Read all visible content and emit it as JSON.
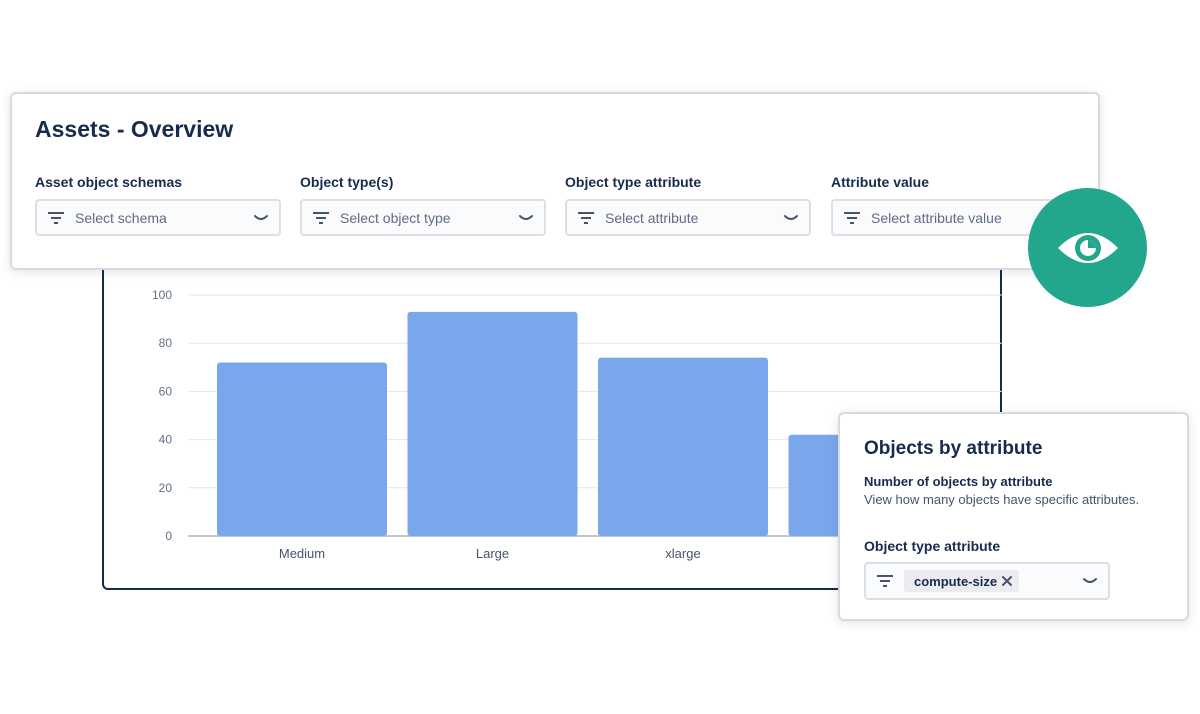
{
  "overview": {
    "title": "Assets - Overview",
    "filters": [
      {
        "label": "Asset object schemas",
        "placeholder": "Select schema"
      },
      {
        "label": "Object type(s)",
        "placeholder": "Select object type"
      },
      {
        "label": "Object type attribute",
        "placeholder": "Select attribute"
      },
      {
        "label": "Attribute value",
        "placeholder": "Select attribute value"
      }
    ]
  },
  "chart_data": {
    "type": "bar",
    "categories": [
      "Medium",
      "Large",
      "xlarge",
      ""
    ],
    "values": [
      72,
      93,
      74,
      42
    ],
    "yticks": [
      "0",
      "20",
      "40",
      "60",
      "80",
      "100"
    ],
    "ylim": [
      0,
      100
    ],
    "grid": true,
    "bar_color": "#7aa7ec"
  },
  "attribute_card": {
    "title": "Objects by attribute",
    "subtitle": "Number of objects by attribute",
    "description": "View how many objects have specific attributes.",
    "field_label": "Object type attribute",
    "selected_chip": "compute-size"
  },
  "icons": {
    "badge": "eye-icon",
    "filter": "filter-icon",
    "dropdown": "chevron-down-icon",
    "remove": "close-icon"
  },
  "colors": {
    "accent_teal": "#23a78c",
    "bar": "#7aa7ec",
    "text_dark": "#172b4d"
  }
}
